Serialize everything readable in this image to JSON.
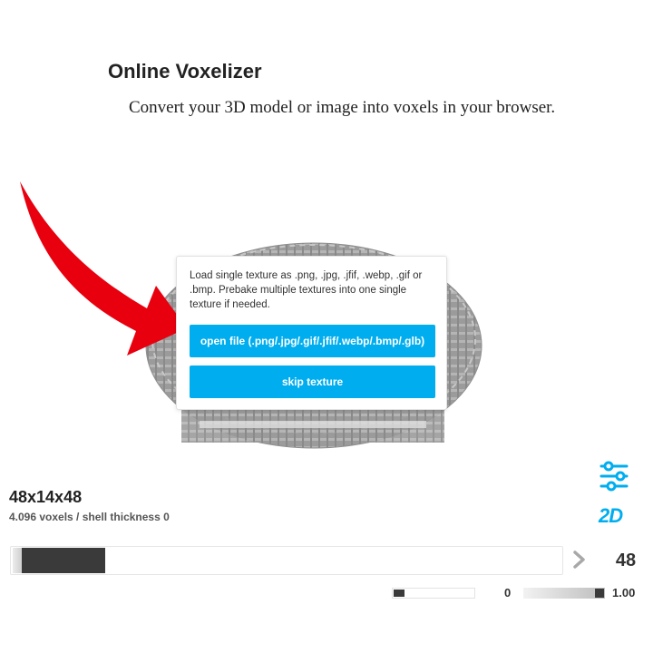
{
  "header": {
    "title": "Online Voxelizer",
    "subtitle": "Convert your 3D model or image into voxels in your browser."
  },
  "dialog": {
    "text": "Load single texture as .png, .jpg, .jfif, .webp, .gif or .bmp. Prebake multiple textures into one single texture if needed.",
    "open_button": "open file (.png/.jpg/.gif/.jfif/.webp/.bmp/.glb)",
    "skip_button": "skip texture"
  },
  "model_info": {
    "dimensions": "48x14x48",
    "stats": "4.096 voxels / shell thickness 0"
  },
  "controls": {
    "settings_icon": "sliders-icon",
    "mode_2d_label": "2D",
    "resolution_value": "48",
    "resolution_fraction": 0.155,
    "shell_value": "0",
    "shell_fraction": 0.0,
    "opacity_value": "1.00",
    "opacity_fraction": 1.0
  },
  "colors": {
    "accent": "#00aeef",
    "dark": "#3a3a3a",
    "arrow": "#e8000f",
    "voxel": "#9a9a9a"
  }
}
